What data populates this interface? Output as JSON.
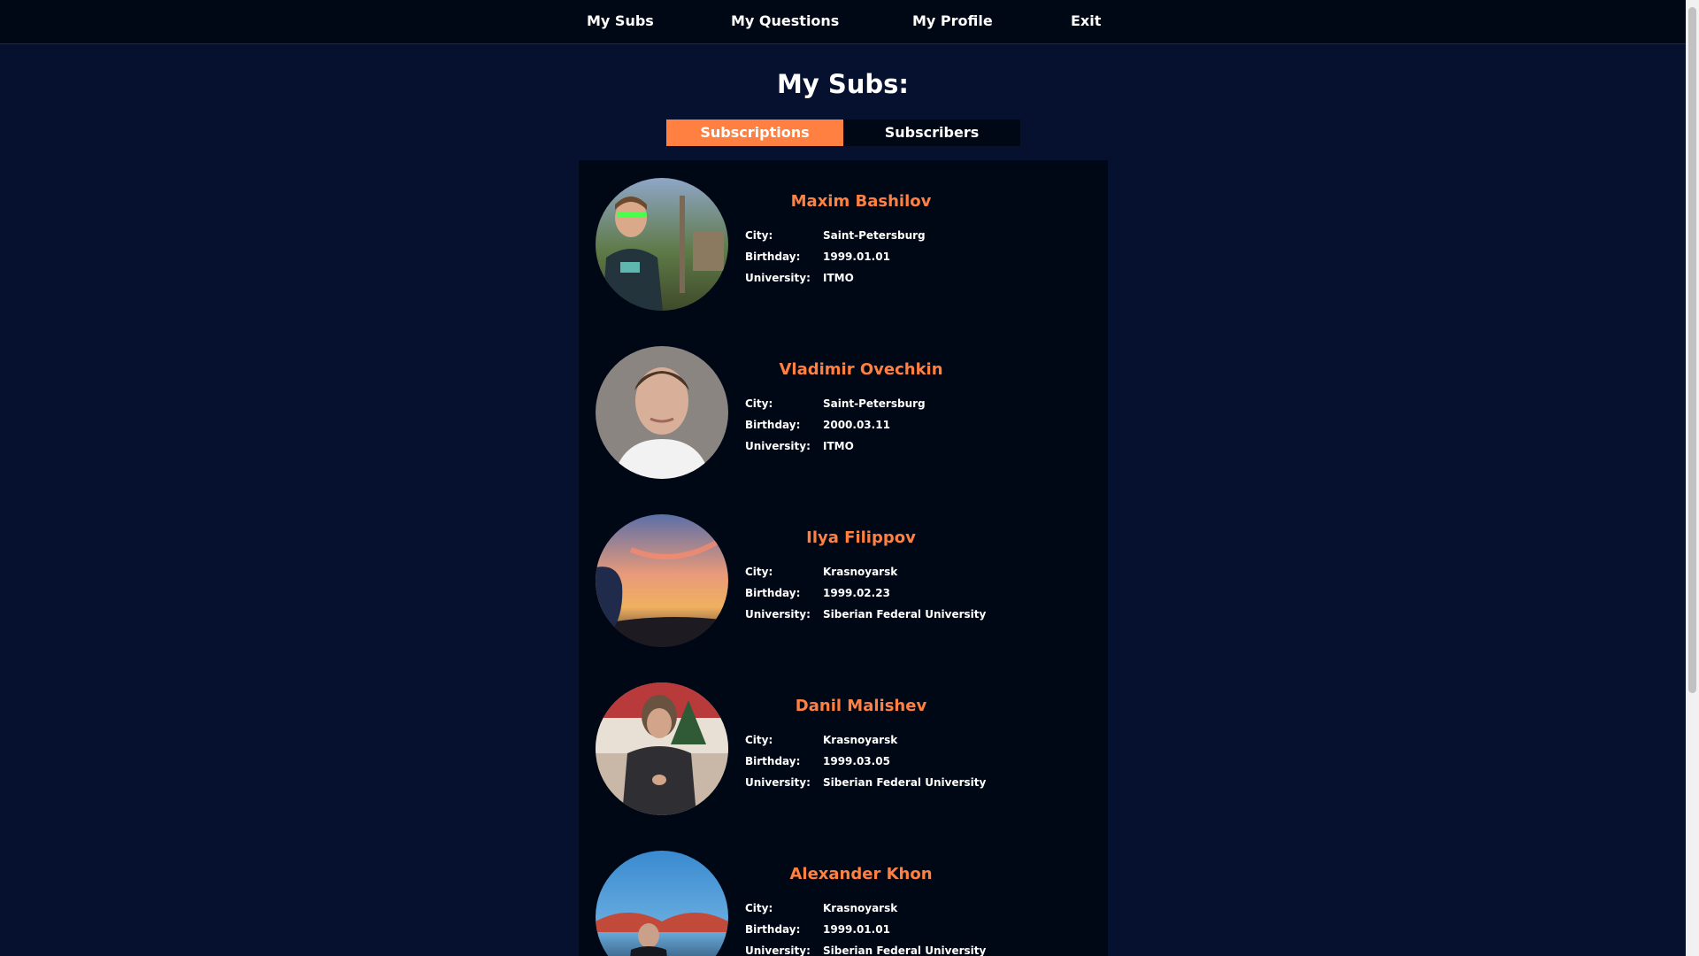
{
  "nav": {
    "my_subs": "My Subs",
    "my_questions": "My Questions",
    "my_profile": "My Profile",
    "exit": "Exit"
  },
  "page_title": "My Subs:",
  "tabs": {
    "subscriptions": "Subscriptions",
    "subscribers": "Subscribers",
    "active": "Subscriptions"
  },
  "colors": {
    "accent": "#ff8040",
    "background": "#061130",
    "panel": "#000715",
    "text": "#ffffff"
  },
  "users": [
    {
      "name": "Maxim Bashilov",
      "city_label": "City:",
      "city": "Saint-Petersburg",
      "birthday_label": "Birthday:",
      "birthday": "1999.01.01",
      "university_label": "University:",
      "university": "ITMO",
      "photo": "user-photo"
    },
    {
      "name": "Vladimir Ovechkin",
      "city_label": "City:",
      "city": "Saint-Petersburg",
      "birthday_label": "Birthday:",
      "birthday": "2000.03.11",
      "university_label": "University:",
      "university": "ITMO",
      "photo": "user-photo"
    },
    {
      "name": "Ilya Filippov",
      "city_label": "City:",
      "city": "Krasnoyarsk",
      "birthday_label": "Birthday:",
      "birthday": "1999.02.23",
      "university_label": "University:",
      "university": "Siberian Federal University",
      "photo": "user-photo"
    },
    {
      "name": "Danil Malishev",
      "city_label": "City:",
      "city": "Krasnoyarsk",
      "birthday_label": "Birthday:",
      "birthday": "1999.03.05",
      "university_label": "University:",
      "university": "Siberian Federal University",
      "photo": "user-photo"
    },
    {
      "name": "Alexander Khon",
      "city_label": "City:",
      "city": "Krasnoyarsk",
      "birthday_label": "Birthday:",
      "birthday": "1999.01.01",
      "university_label": "University:",
      "university": "Siberian Federal University",
      "photo": "user-photo"
    }
  ]
}
